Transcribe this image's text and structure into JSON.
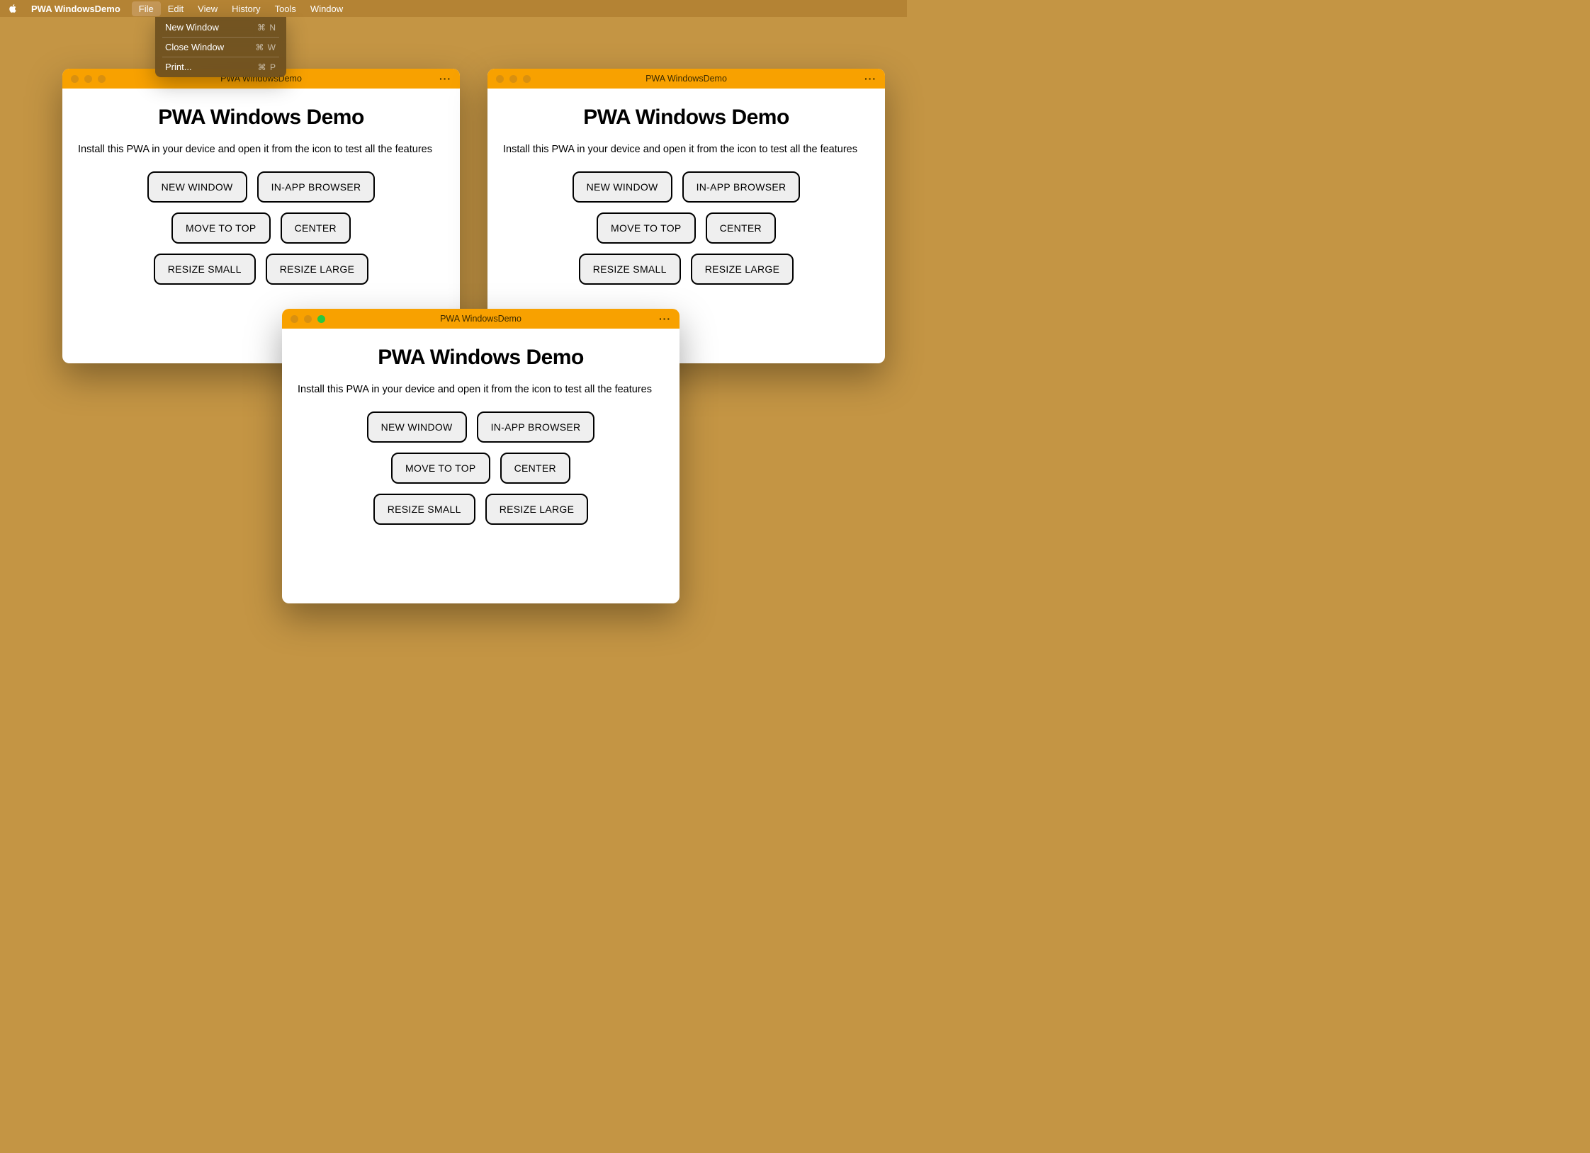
{
  "menubar": {
    "app_name": "PWA WindowsDemo",
    "items": [
      {
        "label": "File",
        "active": true
      },
      {
        "label": "Edit",
        "active": false
      },
      {
        "label": "View",
        "active": false
      },
      {
        "label": "History",
        "active": false
      },
      {
        "label": "Tools",
        "active": false
      },
      {
        "label": "Window",
        "active": false
      }
    ]
  },
  "dropdown": {
    "items": [
      {
        "label": "New Window",
        "shortcut": "⌘ N",
        "sep_after": true
      },
      {
        "label": "Close Window",
        "shortcut": "⌘ W",
        "sep_after": true
      },
      {
        "label": "Print...",
        "shortcut": "⌘ P",
        "sep_after": false
      }
    ]
  },
  "windows": [
    {
      "title": "PWA WindowsDemo",
      "active": false
    },
    {
      "title": "PWA WindowsDemo",
      "active": false
    },
    {
      "title": "PWA WindowsDemo",
      "active": true
    }
  ],
  "content": {
    "heading": "PWA Windows Demo",
    "description": "Install this PWA in your device and open it from the icon to test all the features",
    "buttons": {
      "new_window": "NEW WINDOW",
      "in_app_browser": "IN-APP BROWSER",
      "move_to_top": "MOVE TO TOP",
      "center": "CENTER",
      "resize_small": "RESIZE SMALL",
      "resize_large": "RESIZE LARGE"
    }
  }
}
